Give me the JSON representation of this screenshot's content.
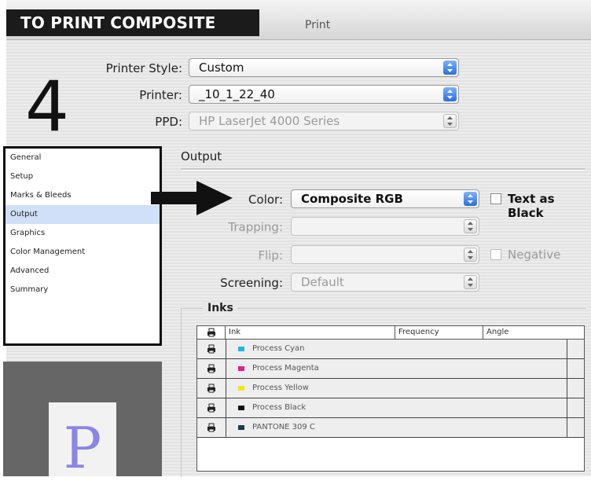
{
  "banner": {
    "title": "TO PRINT COMPOSITE"
  },
  "window": {
    "title": "Print"
  },
  "step": {
    "number": "4"
  },
  "header_fields": {
    "printer_style": {
      "label": "Printer Style:",
      "value": "Custom"
    },
    "printer": {
      "label": "Printer:",
      "value": "_10_1_22_40"
    },
    "ppd": {
      "label": "PPD:",
      "value": "HP LaserJet 4000 Series"
    }
  },
  "sidebar": {
    "items": [
      "General",
      "Setup",
      "Marks & Bleeds",
      "Output",
      "Graphics",
      "Color Management",
      "Advanced",
      "Summary"
    ],
    "selected": "Output"
  },
  "output": {
    "section_label": "Output",
    "color": {
      "label": "Color:",
      "value": "Composite RGB"
    },
    "text_as_black": {
      "label": "Text as Black",
      "checked": false
    },
    "trapping": {
      "label": "Trapping:",
      "value": ""
    },
    "flip": {
      "label": "Flip:",
      "value": ""
    },
    "negative": {
      "label": "Negative",
      "checked": false
    },
    "screening": {
      "label": "Screening:",
      "value": "Default"
    }
  },
  "inks": {
    "label": "Inks",
    "columns": [
      "Ink",
      "Frequency",
      "Angle"
    ],
    "rows": [
      {
        "name": "Process Cyan",
        "color": "#1fb5e8"
      },
      {
        "name": "Process Magenta",
        "color": "#e0208a"
      },
      {
        "name": "Process Yellow",
        "color": "#f2e41a"
      },
      {
        "name": "Process Black",
        "color": "#111111"
      },
      {
        "name": "PANTONE 309 C",
        "color": "#1d3d4a"
      }
    ]
  },
  "preview": {
    "glyph": "P"
  },
  "colors": {
    "accent": "#2a6fe0",
    "banner": "#1b1b1b"
  }
}
